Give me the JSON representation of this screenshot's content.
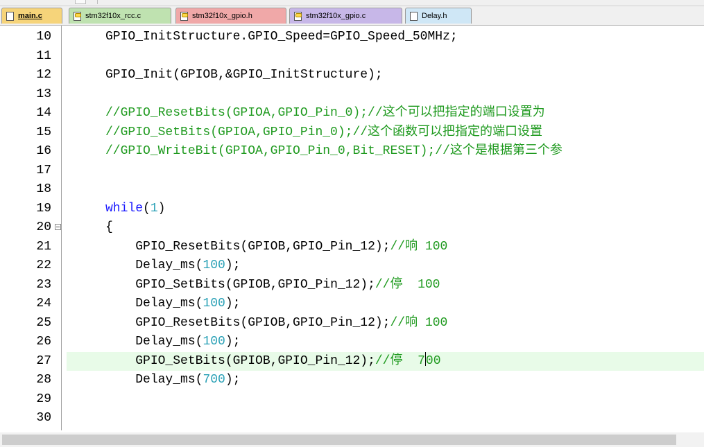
{
  "tabs": [
    {
      "label": "main.c",
      "icon": "file-icon",
      "color": "#f6d47a",
      "active": true
    },
    {
      "label": "stm32f10x_rcc.c",
      "icon": "key-file-icon",
      "color": "#bfe2b0"
    },
    {
      "label": "stm32f10x_gpio.h",
      "icon": "key-file-icon",
      "color": "#f0a8a8"
    },
    {
      "label": "stm32f10x_gpio.c",
      "icon": "key-file-icon",
      "color": "#c7b7e8"
    },
    {
      "label": "Delay.h",
      "icon": "file-icon",
      "color": "#cfe7f6"
    }
  ],
  "editor": {
    "lines": [
      {
        "num": "10",
        "indent": "",
        "parts": [
          {
            "t": "GPIO_InitStructure.GPIO_Speed=GPIO_Speed_50MHz;",
            "c": "plain"
          }
        ]
      },
      {
        "num": "11",
        "indent": "",
        "parts": []
      },
      {
        "num": "12",
        "indent": "",
        "parts": [
          {
            "t": "GPIO_Init(GPIOB,&GPIO_InitStructure);",
            "c": "plain"
          }
        ]
      },
      {
        "num": "13",
        "indent": "",
        "parts": []
      },
      {
        "num": "14",
        "indent": "",
        "parts": [
          {
            "t": "//GPIO_ResetBits(GPIOA,GPIO_Pin_0);//这个可以把指定的端口设置为",
            "c": "comment"
          }
        ]
      },
      {
        "num": "15",
        "indent": "",
        "parts": [
          {
            "t": "//GPIO_SetBits(GPIOA,GPIO_Pin_0);//这个函数可以把指定的端口设置",
            "c": "comment"
          }
        ]
      },
      {
        "num": "16",
        "indent": "",
        "parts": [
          {
            "t": "//GPIO_WriteBit(GPIOA,GPIO_Pin_0,Bit_RESET);//这个是根据第三个参",
            "c": "comment"
          }
        ]
      },
      {
        "num": "17",
        "indent": "",
        "parts": []
      },
      {
        "num": "18",
        "indent": "",
        "parts": []
      },
      {
        "num": "19",
        "indent": "",
        "parts": [
          {
            "t": "while",
            "c": "key"
          },
          {
            "t": "(",
            "c": "plain"
          },
          {
            "t": "1",
            "c": "num"
          },
          {
            "t": ")",
            "c": "plain"
          }
        ]
      },
      {
        "num": "20",
        "indent": "",
        "fold": true,
        "parts": [
          {
            "t": "{",
            "c": "plain"
          }
        ]
      },
      {
        "num": "21",
        "indent": "    ",
        "parts": [
          {
            "t": "GPIO_ResetBits(GPIOB,GPIO_Pin_12);",
            "c": "plain"
          },
          {
            "t": "//响 100",
            "c": "comment"
          }
        ]
      },
      {
        "num": "22",
        "indent": "    ",
        "parts": [
          {
            "t": "Delay_ms(",
            "c": "plain"
          },
          {
            "t": "100",
            "c": "num"
          },
          {
            "t": ");",
            "c": "plain"
          }
        ]
      },
      {
        "num": "23",
        "indent": "    ",
        "parts": [
          {
            "t": "GPIO_SetBits(GPIOB,GPIO_Pin_12);",
            "c": "plain"
          },
          {
            "t": "//停  100",
            "c": "comment"
          }
        ]
      },
      {
        "num": "24",
        "indent": "    ",
        "parts": [
          {
            "t": "Delay_ms(",
            "c": "plain"
          },
          {
            "t": "100",
            "c": "num"
          },
          {
            "t": ");",
            "c": "plain"
          }
        ]
      },
      {
        "num": "25",
        "indent": "    ",
        "parts": [
          {
            "t": "GPIO_ResetBits(GPIOB,GPIO_Pin_12);",
            "c": "plain"
          },
          {
            "t": "//响 100",
            "c": "comment"
          }
        ]
      },
      {
        "num": "26",
        "indent": "    ",
        "parts": [
          {
            "t": "Delay_ms(",
            "c": "plain"
          },
          {
            "t": "100",
            "c": "num"
          },
          {
            "t": ");",
            "c": "plain"
          }
        ]
      },
      {
        "num": "27",
        "indent": "    ",
        "current": true,
        "parts": [
          {
            "t": "GPIO_SetBits(GPIOB,GPIO_Pin_12);",
            "c": "plain"
          },
          {
            "t": "//停  7",
            "c": "comment"
          },
          {
            "t": "",
            "c": "caret"
          },
          {
            "t": "00",
            "c": "comment"
          }
        ]
      },
      {
        "num": "28",
        "indent": "    ",
        "parts": [
          {
            "t": "Delay_ms(",
            "c": "plain"
          },
          {
            "t": "700",
            "c": "num"
          },
          {
            "t": ");",
            "c": "plain"
          }
        ]
      },
      {
        "num": "29",
        "indent": "",
        "parts": []
      },
      {
        "num": "30",
        "indent": "",
        "parts": []
      }
    ]
  }
}
